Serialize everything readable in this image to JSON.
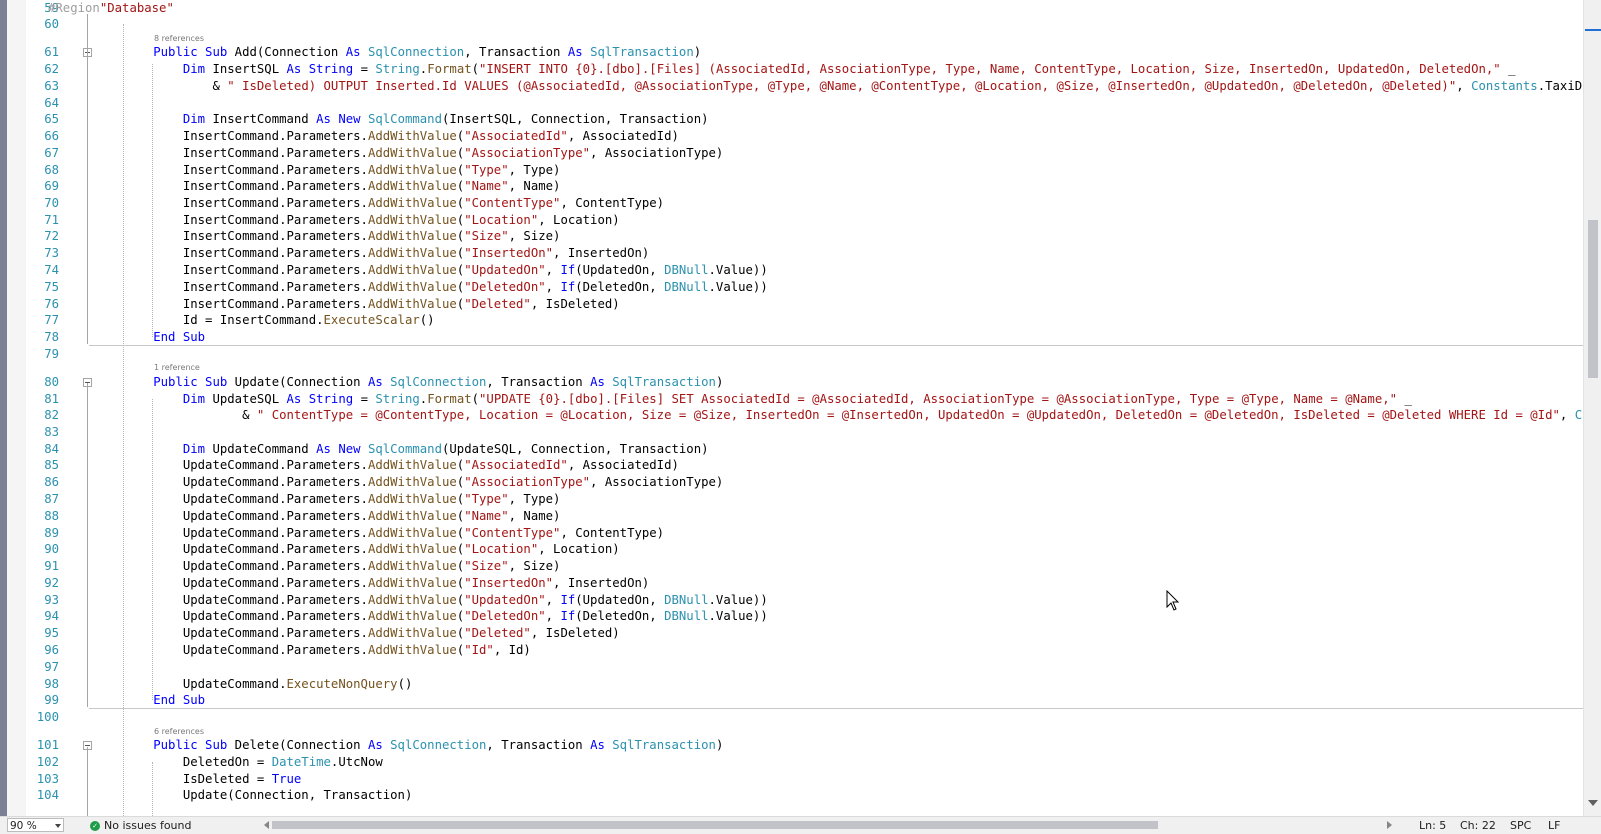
{
  "editor": {
    "region_keyword": "#Region",
    "region_name": "\"Database\"",
    "references": {
      "add": "8 references",
      "update": "1 reference",
      "delete": "6 references"
    }
  },
  "line_numbers": [
    "59",
    "60",
    "61",
    "62",
    "63",
    "64",
    "65",
    "66",
    "67",
    "68",
    "69",
    "70",
    "71",
    "72",
    "73",
    "74",
    "75",
    "76",
    "77",
    "78",
    "79",
    "80",
    "81",
    "82",
    "83",
    "84",
    "85",
    "86",
    "87",
    "88",
    "89",
    "90",
    "91",
    "92",
    "93",
    "94",
    "95",
    "96",
    "97",
    "98",
    "99",
    "100",
    "101",
    "102",
    "103",
    "104"
  ],
  "code": {
    "add_sig": {
      "kw1": "Public Sub ",
      "name": "Add",
      "p1": "(Connection ",
      "as1": "As ",
      "t1": "SqlConnection",
      "p2": ", Transaction ",
      "as2": "As ",
      "t2": "SqlTransaction",
      "p3": ")"
    },
    "l62": {
      "kw1": "Dim ",
      "id": "InsertSQL ",
      "kw2": "As String ",
      "eq": "= ",
      "ty": "String",
      "dot": ".",
      "me": "Format",
      "op": "(",
      "st": "\"INSERT INTO {0}.[dbo].[Files] (AssociatedId, AssociationType, Type, Name, ContentType, Location, Size, InsertedOn, UpdatedOn, DeletedOn,\"",
      "tail": " _"
    },
    "l63": {
      "amp": "& ",
      "st": "\" IsDeleted) OUTPUT Inserted.Id VALUES (@AssociatedId, @AssociationType, @Type, @Name, @ContentType, @Location, @Size, @InsertedOn, @UpdatedOn, @DeletedOn, @Deleted)\"",
      "comma": ", ",
      "ty": "Constants",
      "rest": ".TaxiD"
    },
    "l65": {
      "kw1": "Dim ",
      "id": "InsertCommand ",
      "kw2": "As New ",
      "ty": "SqlCommand",
      "rest": "(InsertSQL, Connection, Transaction)"
    },
    "insert_params": [
      {
        "obj": "InsertCommand.Parameters.",
        "me": "AddWithValue",
        "op": "(",
        "st": "\"AssociatedId\"",
        "rest": ", AssociatedId)"
      },
      {
        "obj": "InsertCommand.Parameters.",
        "me": "AddWithValue",
        "op": "(",
        "st": "\"AssociationType\"",
        "rest": ", AssociationType)"
      },
      {
        "obj": "InsertCommand.Parameters.",
        "me": "AddWithValue",
        "op": "(",
        "st": "\"Type\"",
        "rest": ", Type)"
      },
      {
        "obj": "InsertCommand.Parameters.",
        "me": "AddWithValue",
        "op": "(",
        "st": "\"Name\"",
        "rest": ", Name)"
      },
      {
        "obj": "InsertCommand.Parameters.",
        "me": "AddWithValue",
        "op": "(",
        "st": "\"ContentType\"",
        "rest": ", ContentType)"
      },
      {
        "obj": "InsertCommand.Parameters.",
        "me": "AddWithValue",
        "op": "(",
        "st": "\"Location\"",
        "rest": ", Location)"
      },
      {
        "obj": "InsertCommand.Parameters.",
        "me": "AddWithValue",
        "op": "(",
        "st": "\"Size\"",
        "rest": ", Size)"
      },
      {
        "obj": "InsertCommand.Parameters.",
        "me": "AddWithValue",
        "op": "(",
        "st": "\"InsertedOn\"",
        "rest": ", InsertedOn)"
      }
    ],
    "l74": {
      "obj": "InsertCommand.Parameters.",
      "me": "AddWithValue",
      "op": "(",
      "st": "\"UpdatedOn\"",
      "c": ", ",
      "kw": "If",
      "p": "(UpdatedOn, ",
      "ty": "DBNull",
      "rest": ".Value))"
    },
    "l75": {
      "obj": "InsertCommand.Parameters.",
      "me": "AddWithValue",
      "op": "(",
      "st": "\"DeletedOn\"",
      "c": ", ",
      "kw": "If",
      "p": "(DeletedOn, ",
      "ty": "DBNull",
      "rest": ".Value))"
    },
    "l76": {
      "obj": "InsertCommand.Parameters.",
      "me": "AddWithValue",
      "op": "(",
      "st": "\"Deleted\"",
      "rest": ", IsDeleted)"
    },
    "l77": {
      "a": "Id = InsertCommand.",
      "me": "ExecuteScalar",
      "rest": "()"
    },
    "end_sub": "End Sub",
    "update_sig": {
      "kw1": "Public Sub ",
      "name": "Update",
      "p1": "(Connection ",
      "as1": "As ",
      "t1": "SqlConnection",
      "p2": ", Transaction ",
      "as2": "As ",
      "t2": "SqlTransaction",
      "p3": ")"
    },
    "l81": {
      "kw1": "Dim ",
      "id": "UpdateSQL ",
      "kw2": "As String ",
      "eq": "= ",
      "ty": "String",
      "dot": ".",
      "me": "Format",
      "op": "(",
      "st": "\"UPDATE {0}.[dbo].[Files] SET AssociatedId = @AssociatedId, AssociationType = @AssociationType, Type = @Type, Name = @Name,\"",
      "tail": " _"
    },
    "l82": {
      "amp": "& ",
      "st": "\" ContentType = @ContentType, Location = @Location, Size = @Size, InsertedOn = @InsertedOn, UpdatedOn = @UpdatedOn, DeletedOn = @DeletedOn, IsDeleted = @Deleted WHERE Id = @Id\"",
      "comma": ", ",
      "ty": "C"
    },
    "l84": {
      "kw1": "Dim ",
      "id": "UpdateCommand ",
      "kw2": "As New ",
      "ty": "SqlCommand",
      "rest": "(UpdateSQL, Connection, Transaction)"
    },
    "update_params": [
      {
        "obj": "UpdateCommand.Parameters.",
        "me": "AddWithValue",
        "op": "(",
        "st": "\"AssociatedId\"",
        "rest": ", AssociatedId)"
      },
      {
        "obj": "UpdateCommand.Parameters.",
        "me": "AddWithValue",
        "op": "(",
        "st": "\"AssociationType\"",
        "rest": ", AssociationType)"
      },
      {
        "obj": "UpdateCommand.Parameters.",
        "me": "AddWithValue",
        "op": "(",
        "st": "\"Type\"",
        "rest": ", Type)"
      },
      {
        "obj": "UpdateCommand.Parameters.",
        "me": "AddWithValue",
        "op": "(",
        "st": "\"Name\"",
        "rest": ", Name)"
      },
      {
        "obj": "UpdateCommand.Parameters.",
        "me": "AddWithValue",
        "op": "(",
        "st": "\"ContentType\"",
        "rest": ", ContentType)"
      },
      {
        "obj": "UpdateCommand.Parameters.",
        "me": "AddWithValue",
        "op": "(",
        "st": "\"Location\"",
        "rest": ", Location)"
      },
      {
        "obj": "UpdateCommand.Parameters.",
        "me": "AddWithValue",
        "op": "(",
        "st": "\"Size\"",
        "rest": ", Size)"
      },
      {
        "obj": "UpdateCommand.Parameters.",
        "me": "AddWithValue",
        "op": "(",
        "st": "\"InsertedOn\"",
        "rest": ", InsertedOn)"
      }
    ],
    "l93": {
      "obj": "UpdateCommand.Parameters.",
      "me": "AddWithValue",
      "op": "(",
      "st": "\"UpdatedOn\"",
      "c": ", ",
      "kw": "If",
      "p": "(UpdatedOn, ",
      "ty": "DBNull",
      "rest": ".Value))"
    },
    "l94": {
      "obj": "UpdateCommand.Parameters.",
      "me": "AddWithValue",
      "op": "(",
      "st": "\"DeletedOn\"",
      "c": ", ",
      "kw": "If",
      "p": "(DeletedOn, ",
      "ty": "DBNull",
      "rest": ".Value))"
    },
    "l95": {
      "obj": "UpdateCommand.Parameters.",
      "me": "AddWithValue",
      "op": "(",
      "st": "\"Deleted\"",
      "rest": ", IsDeleted)"
    },
    "l96": {
      "obj": "UpdateCommand.Parameters.",
      "me": "AddWithValue",
      "op": "(",
      "st": "\"Id\"",
      "rest": ", Id)"
    },
    "l98": {
      "a": "UpdateCommand.",
      "me": "ExecuteNonQuery",
      "rest": "()"
    },
    "delete_sig": {
      "kw1": "Public Sub ",
      "name": "Delete",
      "p1": "(Connection ",
      "as1": "As ",
      "t1": "SqlConnection",
      "p2": ", Transaction ",
      "as2": "As ",
      "t2": "SqlTransaction",
      "p3": ")"
    },
    "l102": {
      "a": "DeletedOn = ",
      "ty": "DateTime",
      "rest": ".UtcNow"
    },
    "l103": {
      "a": "IsDeleted = ",
      "kw": "True"
    },
    "l104": {
      "a": "Update(Connection, Transaction)"
    }
  },
  "statusbar": {
    "zoom": "90 %",
    "issues": "No issues found",
    "ln": "Ln: 5",
    "ch": "Ch: 22",
    "spc": "SPC",
    "lf": "LF"
  },
  "colors": {
    "keyword": "#0000ff",
    "type": "#2b91af",
    "string": "#a31515",
    "method": "#74531f",
    "line_number": "#2b91af"
  }
}
